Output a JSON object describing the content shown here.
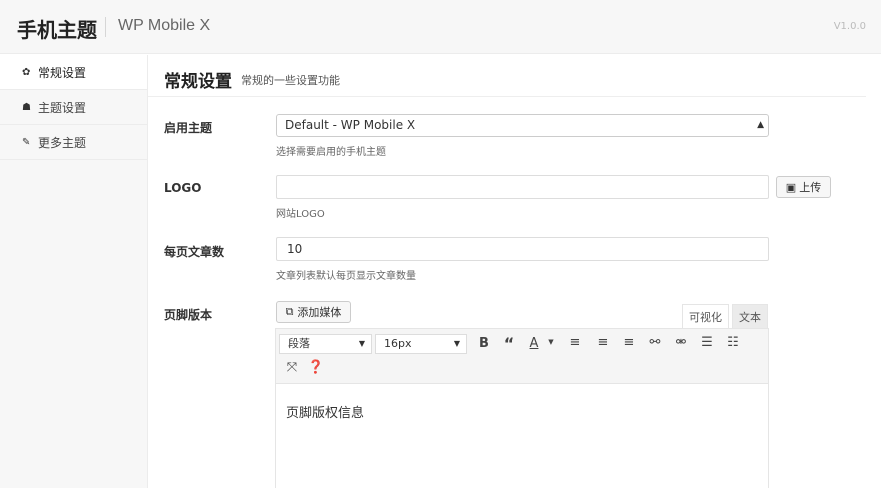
{
  "header": {
    "title": "手机主题",
    "subtitle": "WP Mobile X",
    "version": "V1.0.0"
  },
  "sidebar": {
    "items": [
      {
        "label": "常规设置",
        "icon": "gear-icon",
        "glyph": "✿",
        "active": true
      },
      {
        "label": "主题设置",
        "icon": "home-icon",
        "glyph": "☗",
        "active": false
      },
      {
        "label": "更多主题",
        "icon": "wrench-icon",
        "glyph": "✎",
        "active": false
      }
    ]
  },
  "page": {
    "title": "常规设置",
    "description": "常规的一些设置功能"
  },
  "fields": {
    "theme": {
      "label": "启用主题",
      "value": "Default - WP Mobile X",
      "help": "选择需要启用的手机主题"
    },
    "logo": {
      "label": "LOGO",
      "value": "",
      "help": "网站LOGO",
      "upload_label": "上传"
    },
    "posts_per_page": {
      "label": "每页文章数",
      "value": "10",
      "help": "文章列表默认每页显示文章数量"
    },
    "footer": {
      "label": "页脚版本",
      "media_button": "添加媒体",
      "tab_visual": "可视化",
      "tab_text": "文本",
      "format_select": "段落",
      "size_select": "16px",
      "content": "页脚版权信息"
    }
  }
}
